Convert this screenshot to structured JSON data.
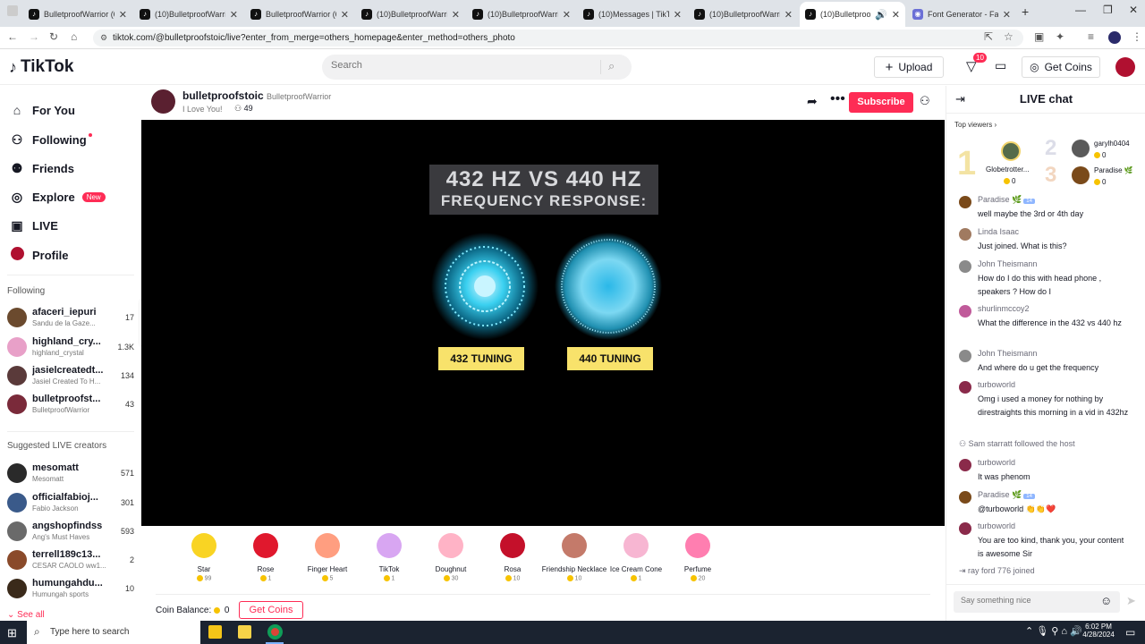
{
  "browser": {
    "tabs": [
      {
        "label": "BulletproofWarrior (6..."
      },
      {
        "label": "(10)BulletproofWarrio..."
      },
      {
        "label": "BulletproofWarrior (6..."
      },
      {
        "label": "(10)BulletproofWarrio..."
      },
      {
        "label": "(10)BulletproofWarrio..."
      },
      {
        "label": "(10)Messages | TikTok"
      },
      {
        "label": "(10)BulletproofWarrio..."
      },
      {
        "label": "(10)BulletproofW..."
      },
      {
        "label": "Font Generator - Fan..."
      }
    ],
    "url": "tiktok.com/@bulletproofstoic/live?enter_from_merge=others_homepage&enter_method=others_photo"
  },
  "header": {
    "logo": "TikTok",
    "search_placeholder": "Search",
    "upload_label": "Upload",
    "inbox_count": "10",
    "get_coins_label": "Get Coins"
  },
  "sidebar": {
    "nav": [
      {
        "label": "For You",
        "icon": "home-icon"
      },
      {
        "label": "Following",
        "icon": "following-icon"
      },
      {
        "label": "Friends",
        "icon": "friends-icon"
      },
      {
        "label": "Explore",
        "icon": "compass-icon"
      },
      {
        "label": "LIVE",
        "icon": "live-icon"
      },
      {
        "label": "Profile",
        "icon": "avatar"
      }
    ],
    "explore_badge": "New",
    "following_title": "Following",
    "following": [
      {
        "name": "afaceri_iepuri",
        "sub": "Sandu de la Gaze...",
        "count": "17",
        "color": "#6b4a2e"
      },
      {
        "name": "highland_cry...",
        "sub": "highland_crystal",
        "count": "1.3K",
        "color": "#e8a0c8"
      },
      {
        "name": "jasielcreatedt...",
        "sub": "Jasiel Created To H...",
        "count": "134",
        "color": "#5a3a3a"
      },
      {
        "name": "bulletproofst...",
        "sub": "BulletproofWarrior",
        "count": "43",
        "color": "#7a2a3a"
      }
    ],
    "suggested_title": "Suggested LIVE creators",
    "suggested": [
      {
        "name": "mesomatt",
        "sub": "Mesomatt",
        "count": "571",
        "color": "#2a2a2a"
      },
      {
        "name": "officialfabioj...",
        "sub": "Fabio Jackson",
        "count": "301",
        "color": "#3a5a8a"
      },
      {
        "name": "angshopfindss",
        "sub": "Ang's Must Haves",
        "count": "593",
        "color": "#6a6a6a"
      },
      {
        "name": "terrell189c13...",
        "sub": "CESAR CAOLO ww1...",
        "count": "2",
        "color": "#8a4a2a"
      },
      {
        "name": "humungahdu...",
        "sub": "Humungah sports",
        "count": "10",
        "color": "#3a2a1a"
      }
    ],
    "see_all": "See all"
  },
  "stream": {
    "username": "bulletproofstoic",
    "display_name": "BulletproofWarrior",
    "tagline": "I Love You!",
    "viewers": "49",
    "subscribe_label": "Subscribe",
    "video_title_line1": "432 HZ VS 440 HZ",
    "video_title_line2": "FREQUENCY RESPONSE:",
    "left_label": "432 TUNING",
    "right_label": "440 TUNING"
  },
  "gifts": [
    {
      "name": "Star",
      "cost": "99",
      "color": "#f9d423"
    },
    {
      "name": "Rose",
      "cost": "1",
      "color": "#e0182d"
    },
    {
      "name": "Finger Heart",
      "cost": "5",
      "color": "#ff9e80"
    },
    {
      "name": "TikTok",
      "cost": "1",
      "color": "#d8a6f2"
    },
    {
      "name": "Doughnut",
      "cost": "30",
      "color": "#ffb3c6"
    },
    {
      "name": "Rosa",
      "cost": "10",
      "color": "#c4102a"
    },
    {
      "name": "Friendship Necklace",
      "cost": "10",
      "color": "#c47a6a"
    },
    {
      "name": "Ice Cream Cone",
      "cost": "1",
      "color": "#f7b6d2"
    },
    {
      "name": "Perfume",
      "cost": "20",
      "color": "#ff7eb0"
    }
  ],
  "coin_balance_label": "Coin Balance:",
  "coin_balance": "0",
  "gifts_get_coins": "Get Coins",
  "chat": {
    "title": "LIVE chat",
    "top_viewers_label": "Top viewers",
    "top_viewers": [
      {
        "rank": "1",
        "name": "Globetrotter...",
        "coins": "0"
      },
      {
        "rank": "2",
        "name": "garylh0404",
        "coins": "0"
      },
      {
        "rank": "3",
        "name": "Paradise 🌿",
        "coins": "0"
      }
    ],
    "messages": [
      {
        "user": "Paradise 🌿",
        "badge": "14",
        "text": "well maybe the 3rd or 4th day",
        "color": "#7a4a1a"
      },
      {
        "user": "Linda Isaac",
        "badge": "",
        "text": "Just joined. What is this?",
        "color": "#a07a60"
      },
      {
        "user": "John Theismann",
        "badge": "",
        "text": "How do I do this with head phone , speakers ? How do I",
        "color": "#8a8a8a"
      },
      {
        "user": "shurlinmccoy2",
        "badge": "",
        "text": "What the difference in the 432 vs 440 hz",
        "color": "#c05a9a"
      },
      {
        "user": "John Theismann",
        "badge": "",
        "text": "And where do u get the frequency",
        "color": "#8a8a8a"
      },
      {
        "user": "turboworld",
        "badge": "",
        "text": "Omg i used a money for nothing by direstraights this morning in a vid in 432hz",
        "color": "#8a2a4a"
      },
      {
        "user": "turboworld",
        "badge": "",
        "text": "It was phenom",
        "color": "#8a2a4a"
      },
      {
        "user": "Paradise 🌿",
        "badge": "14",
        "text": "@turboworld 👏👏❤️",
        "color": "#7a4a1a"
      },
      {
        "user": "turboworld",
        "badge": "",
        "text": "You are too kind, thank you, your content is awesome Sir",
        "color": "#8a2a4a"
      }
    ],
    "follow_event": "Sam starratt followed the host",
    "join_event": "ray ford 776 joined",
    "input_placeholder": "Say something nice"
  },
  "taskbar": {
    "search_placeholder": "Type here to search",
    "time": "6:02 PM",
    "date": "4/28/2024"
  }
}
